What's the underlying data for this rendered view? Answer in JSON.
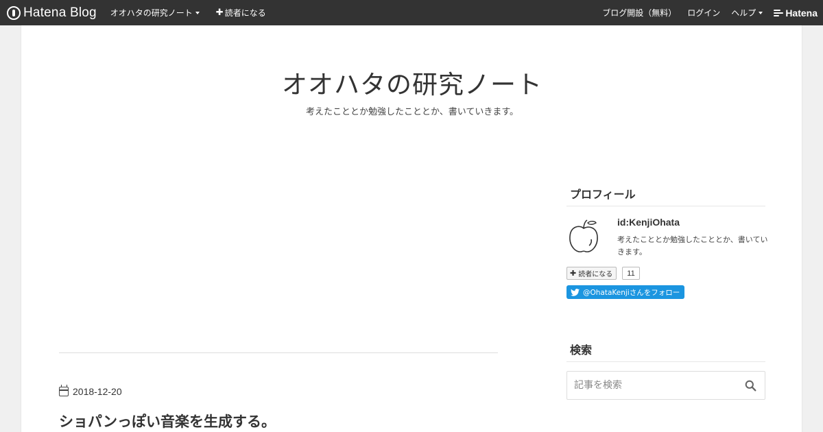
{
  "topbar": {
    "brand": "Hatena Blog",
    "blog_menu": "オオハタの研究ノート",
    "subscribe": "読者になる",
    "create_blog": "ブログ開設（無料）",
    "login": "ログイン",
    "help": "ヘルプ",
    "hatena": "Hatena"
  },
  "header": {
    "title": "オオハタの研究ノート",
    "description": "考えたこととか勉強したこととか、書いていきます。"
  },
  "entry": {
    "date": "2018-12-20",
    "title": "ショパンっぽい音楽を生成する。"
  },
  "sidebar": {
    "profile": {
      "heading": "プロフィール",
      "user_id": "id:KenjiOhata",
      "description": "考えたこととか勉強したこととか、書いていきます。",
      "subscribe_label": "読者になる",
      "subscriber_count": "11",
      "twitter_follow": "@OhataKenjiさんをフォロー"
    },
    "search": {
      "heading": "検索",
      "placeholder": "記事を検索"
    }
  },
  "colors": {
    "topbar_bg": "#333333",
    "twitter_blue": "#1b95e0",
    "page_bg": "#f0f0f0"
  }
}
